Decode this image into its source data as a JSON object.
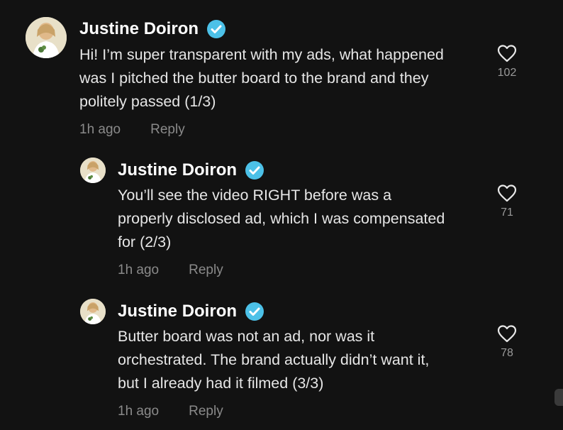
{
  "comments": [
    {
      "author": "Justine Doiron",
      "lines": [
        "Hi! I’m super transparent with my ads, what happened",
        "was I pitched the butter board to the brand and they",
        "politely passed (1/3)"
      ],
      "time": "1h ago",
      "reply_label": "Reply",
      "likes": "102"
    },
    {
      "author": "Justine Doiron",
      "lines": [
        "You’ll see the video RIGHT before was a",
        "properly disclosed ad, which I was compensated",
        "for (2/3)"
      ],
      "time": "1h ago",
      "reply_label": "Reply",
      "likes": "71"
    },
    {
      "author": "Justine Doiron",
      "lines": [
        "Butter board was not an ad, nor was it",
        "orchestrated. The brand actually didn’t want it,",
        "but I already had it filmed (3/3)"
      ],
      "time": "1h ago",
      "reply_label": "Reply",
      "likes": "78"
    }
  ],
  "icons": {
    "verified": "verified-badge-icon",
    "heart": "heart-outline-icon"
  },
  "colors": {
    "background": "#121212",
    "verified": "#4cc1e8",
    "muted_text": "#8a8a8a"
  }
}
